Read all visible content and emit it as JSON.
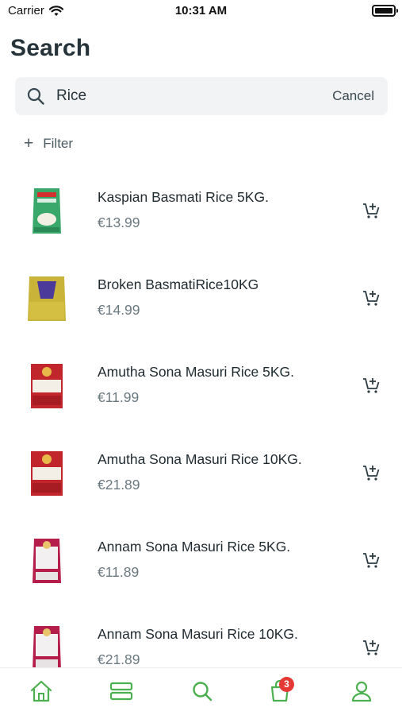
{
  "status_bar": {
    "carrier": "Carrier",
    "time": "10:31 AM"
  },
  "header": {
    "title": "Search"
  },
  "search": {
    "query": "Rice",
    "cancel_label": "Cancel"
  },
  "filter": {
    "label": "Filter"
  },
  "products": [
    {
      "name": "Kaspian Basmati Rice 5KG.",
      "price": "€13.99"
    },
    {
      "name": "Broken BasmatiRice10KG",
      "price": "€14.99"
    },
    {
      "name": "Amutha Sona Masuri Rice 5KG.",
      "price": "€11.99"
    },
    {
      "name": "Amutha Sona Masuri Rice 10KG.",
      "price": "€21.89"
    },
    {
      "name": "Annam Sona Masuri Rice 5KG.",
      "price": "€11.89"
    },
    {
      "name": "Annam Sona Masuri Rice 10KG.",
      "price": "€21.89"
    }
  ],
  "tab_bar": {
    "cart_badge": "3"
  },
  "colors": {
    "accent": "#4caf50",
    "badge": "#e53935",
    "icon_dark": "#2e3c44"
  },
  "icons": [
    "wifi-icon",
    "battery-icon",
    "search-icon",
    "plus-icon",
    "cart-add-icon",
    "home-icon",
    "categories-icon",
    "cart-icon",
    "user-icon"
  ]
}
